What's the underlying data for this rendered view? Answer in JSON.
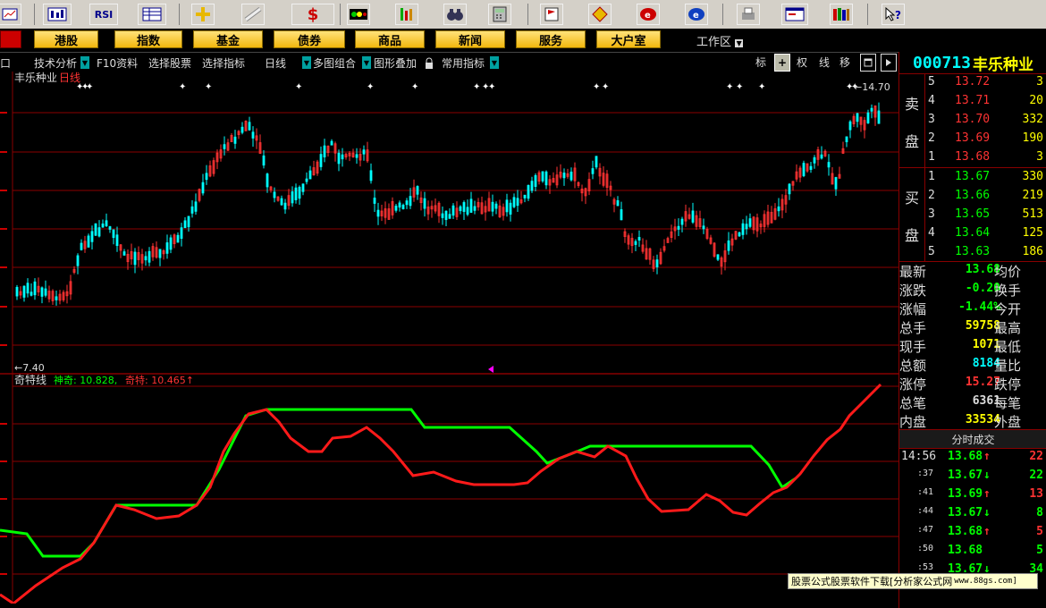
{
  "toolbar": {
    "rsi_label": "RSI",
    "dollar_label": "$"
  },
  "menu": {
    "items": [
      "港股",
      "指数",
      "基金",
      "债券",
      "商品",
      "新闻",
      "服务",
      "大户室"
    ],
    "workarea": "工作区"
  },
  "subbar": {
    "items": [
      "口",
      "技术分析",
      "F10资料",
      "选择股票",
      "选择指标",
      "日线",
      "多图组合",
      "图形叠加",
      "常用指标"
    ],
    "right_buttons": [
      "标",
      "权",
      "线",
      "移"
    ]
  },
  "chart": {
    "stock_title": "丰乐种业",
    "period_label": "日线",
    "low_marker": "←7.40",
    "high_marker": "←14.70",
    "indicator_name": "奇特线",
    "shenqi_label": "神奇: 10.828,",
    "qite_label": "奇特: 10.465↑"
  },
  "quote": {
    "code": "000713",
    "name": "丰乐种业",
    "sell_label_top": "卖",
    "sell_label_bottom": "盘",
    "buy_label_top": "买",
    "buy_label_bottom": "盘",
    "sell": [
      {
        "level": "5",
        "price": "13.72",
        "volume": "3"
      },
      {
        "level": "4",
        "price": "13.71",
        "volume": "20"
      },
      {
        "level": "3",
        "price": "13.70",
        "volume": "332"
      },
      {
        "level": "2",
        "price": "13.69",
        "volume": "190"
      },
      {
        "level": "1",
        "price": "13.68",
        "volume": "3"
      }
    ],
    "buy": [
      {
        "level": "1",
        "price": "13.67",
        "volume": "330"
      },
      {
        "level": "2",
        "price": "13.66",
        "volume": "219"
      },
      {
        "level": "3",
        "price": "13.65",
        "volume": "513"
      },
      {
        "level": "4",
        "price": "13.64",
        "volume": "125"
      },
      {
        "level": "5",
        "price": "13.63",
        "volume": "186"
      }
    ],
    "stats": [
      {
        "label": "最新",
        "value": "13.68",
        "label2": "均价"
      },
      {
        "label": "涨跌",
        "value": "-0.20",
        "label2": "换手"
      },
      {
        "label": "涨幅",
        "value": "-1.44%",
        "label2": "今开"
      },
      {
        "label": "总手",
        "value": "59758",
        "label2": "最高"
      },
      {
        "label": "现手",
        "value": "1071",
        "label2": "最低"
      },
      {
        "label": "总额",
        "value": "8184",
        "label2": "量比"
      },
      {
        "label": "涨停",
        "value": "15.27",
        "label2": "跌停"
      },
      {
        "label": "总笔",
        "value": "6361",
        "label2": "每笔"
      },
      {
        "label": "内盘",
        "value": "33534",
        "label2": "外盘"
      }
    ],
    "ticks_title": "分时成交",
    "ticks": [
      {
        "time": "14:56",
        "price": "13.68",
        "dir": "↑",
        "vol": "22"
      },
      {
        "time": ":37",
        "price": "13.67",
        "dir": "↓",
        "vol": "22"
      },
      {
        "time": ":41",
        "price": "13.69",
        "dir": "↑",
        "vol": "13"
      },
      {
        "time": ":44",
        "price": "13.67",
        "dir": "↓",
        "vol": "8"
      },
      {
        "time": ":47",
        "price": "13.68",
        "dir": "↑",
        "vol": "5"
      },
      {
        "time": ":50",
        "price": "13.68",
        "dir": "",
        "vol": "5"
      },
      {
        "time": ":53",
        "price": "13.67",
        "dir": "↓",
        "vol": "34"
      }
    ]
  },
  "watermark": {
    "text": "股票公式股票软件下载[分析家公式网",
    "url": "www.88gs.com]"
  },
  "colors": {
    "up": "#ff3333",
    "down": "#00ffff",
    "green": "#00ff00",
    "yellow": "#ffff00",
    "grid": "#8b0000"
  }
}
